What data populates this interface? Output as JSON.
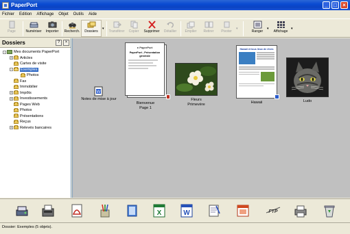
{
  "window": {
    "title": "PaperPort"
  },
  "menu": [
    "Fichier",
    "Edition",
    "Affichage",
    "Objet",
    "Outils",
    "Aide"
  ],
  "toolbar": {
    "page": "Page",
    "numeriser": "Numériser",
    "importer": "Importer",
    "rechercher": "Recherch.",
    "dossiers": "Dossiers",
    "transferer": "Transférer",
    "copier": "Copier",
    "supprimer": "Supprimer",
    "detailler": "Détailler",
    "empiler": "Empiler",
    "retirer": "Retirer",
    "pivoter": "Pivoter",
    "ranger": "Ranger",
    "affichage": "Affichage"
  },
  "sidebar": {
    "title": "Dossiers",
    "root": "Mes documents PaperPort",
    "items": [
      {
        "label": "Articles",
        "expand": "+",
        "level": 1
      },
      {
        "label": "Cartes de visite",
        "expand": "",
        "level": 1
      },
      {
        "label": "Exemples",
        "expand": "-",
        "level": 1,
        "selected": true
      },
      {
        "label": "Photos",
        "expand": "",
        "level": 2
      },
      {
        "label": "Fax",
        "expand": "",
        "level": 1
      },
      {
        "label": "Immobilier",
        "expand": "",
        "level": 1
      },
      {
        "label": "Impôts",
        "expand": "+",
        "level": 1
      },
      {
        "label": "Investissements",
        "expand": "+",
        "level": 1
      },
      {
        "label": "Pages Web",
        "expand": "",
        "level": 1
      },
      {
        "label": "Photos",
        "expand": "",
        "level": 1
      },
      {
        "label": "Présentations",
        "expand": "",
        "level": 1
      },
      {
        "label": "Reçus",
        "expand": "",
        "level": 1
      },
      {
        "label": "Relevés bancaires",
        "expand": "+",
        "level": 1
      }
    ]
  },
  "documents": {
    "notes": "Notes de mise à jour",
    "bienvenue_l1": "Bienvenue",
    "bienvenue_l2": "Page 1",
    "fleurs_l1": "Fleurs",
    "fleurs_l2": "Primevère",
    "hawaii": "Hawaii",
    "ludo": "Ludo",
    "bienvenue_heading": "PaperPort - Présentation générale",
    "hawaii_heading": "Hawaii et tous lieux de rêves"
  },
  "bottom_apps": [
    "scanner-icon",
    "fax-icon",
    "pdf-icon",
    "paint-icon",
    "notes-icon",
    "excel-icon",
    "word-icon",
    "notepad-icon",
    "powerpoint-icon",
    "ftp-icon",
    "print-icon",
    "recycle-bin-icon"
  ],
  "status": {
    "text": "Dossier: Exemples (5 objets)."
  },
  "colors": {
    "titlebar": "#0a4bd2",
    "selection": "#316ac5",
    "workspace": "#c0c0c0",
    "chrome": "#ece9d8"
  }
}
